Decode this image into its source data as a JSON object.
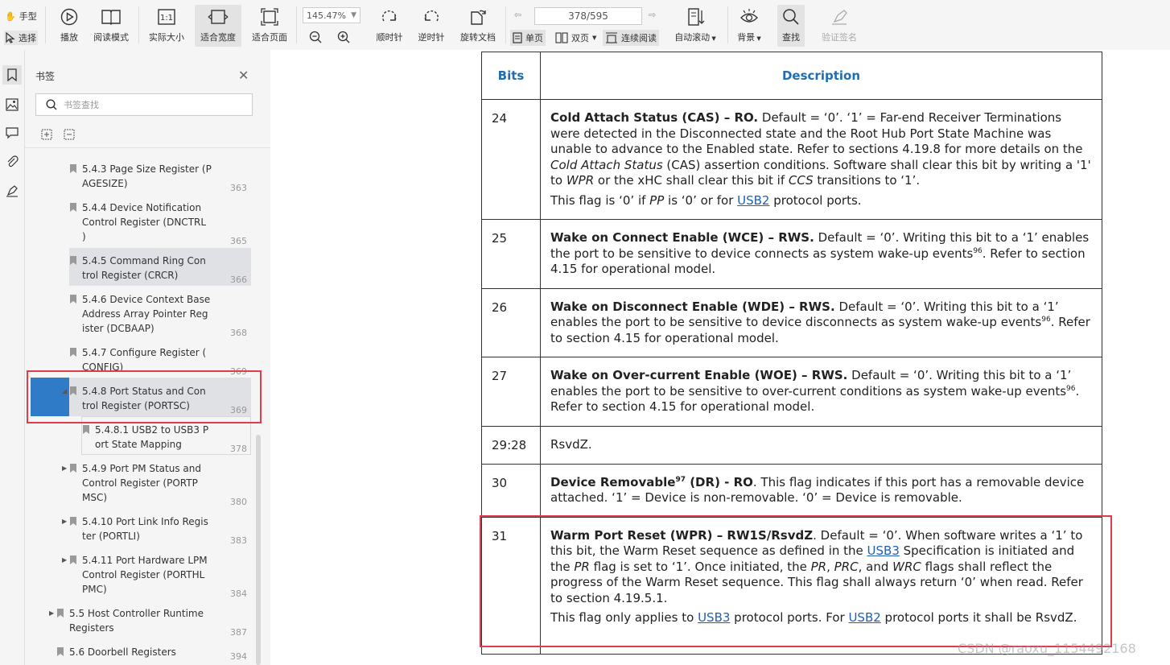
{
  "toolbar": {
    "hand_tool": "手型",
    "select_tool": "选择",
    "play": "播放",
    "read_mode": "阅读模式",
    "actual_size": "实际大小",
    "fit_width": "适合宽度",
    "fit_page": "适合页面",
    "zoom_value": "145.47%",
    "rotate_cw": "顺时针",
    "rotate_ccw": "逆时针",
    "rotate_doc": "旋转文档",
    "page_current": "378/595",
    "single_page": "单页",
    "double_page": "双页",
    "continuous": "连续阅读",
    "auto_scroll": "自动滚动",
    "background": "背景",
    "find": "查找",
    "verify_sign": "验证签名"
  },
  "panel": {
    "title": "书签",
    "search_placeholder": "书签查找",
    "bookmarks": [
      {
        "line1": "5.4.3 Page Size Register (P",
        "line2": "AGESIZE)",
        "line3": "",
        "page": "363"
      },
      {
        "line1": "5.4.4 Device Notification",
        "line2": "Control Register (DNCTRL",
        "line3": ")",
        "page": "365"
      },
      {
        "line1": "5.4.5 Command Ring Con",
        "line2": "trol Register (CRCR)",
        "line3": "",
        "page": "366"
      },
      {
        "line1": "5.4.6 Device Context Base",
        "line2": "Address Array Pointer Reg",
        "line3": "ister (DCBAAP)",
        "page": "368"
      },
      {
        "line1": "5.4.7 Configure Register (",
        "line2": "CONFIG)",
        "line3": "",
        "page": "369"
      },
      {
        "line1": "5.4.8 Port Status and Con",
        "line2": "trol Register (PORTSC)",
        "line3": "",
        "page": "369"
      },
      {
        "line1": "5.4.8.1 USB2 to USB3 P",
        "line2": "ort State Mapping",
        "line3": "",
        "page": "378"
      },
      {
        "line1": "5.4.9 Port PM Status and",
        "line2": "Control Register (PORTP",
        "line3": "MSC)",
        "page": "380"
      },
      {
        "line1": "5.4.10 Port Link Info Regis",
        "line2": "ter (PORTLI)",
        "line3": "",
        "page": "383"
      },
      {
        "line1": "5.4.11 Port Hardware LPM",
        "line2": "Control Register (PORTHL",
        "line3": "PMC)",
        "page": "384"
      },
      {
        "line1": "5.5 Host Controller Runtime",
        "line2": "Registers",
        "line3": "",
        "page": "387"
      },
      {
        "line1": "5.6 Doorbell Registers",
        "line2": "",
        "line3": "",
        "page": "394"
      }
    ]
  },
  "table": {
    "header_bits": "Bits",
    "header_desc": "Description",
    "rows": {
      "r24": {
        "bits": "24",
        "title": "Cold Attach Status (CAS) – RO.",
        "t1": " Default = ‘0’. ‘1’ = Far-end Receiver Terminations were detected in the Disconnected state and the Root Hub Port State Machine was unable to advance to the Enabled state. Refer to sections 4.19.8 for more details on the ",
        "i1": "Cold Attach Status",
        "t2": " (CAS) assertion conditions. Software shall clear this bit by writing a '1' to ",
        "i2": "WPR",
        "t3": " or the xHC shall clear this bit if ",
        "i3": "CCS",
        "t4": " transitions to ‘1’.",
        "p2a": "This flag is ‘0’ if ",
        "p2i": "PP",
        "p2b": " is ‘0’ or for ",
        "p2link": "USB2",
        "p2c": " protocol ports."
      },
      "r25": {
        "bits": "25",
        "title": "Wake on Connect Enable (WCE) – RWS.",
        "t1": " Default = ‘0’. Writing this bit to a ‘1’ enables the port to be sensitive to device connects as system wake-up events",
        "sup": "96",
        "t2": ". Refer to section 4.15 for operational model."
      },
      "r26": {
        "bits": "26",
        "title": "Wake on Disconnect Enable (WDE) – RWS.",
        "t1": " Default = ‘0’. Writing this bit to a ‘1’ enables the port to be sensitive to device disconnects as system wake-up events",
        "sup": "96",
        "t2": ". Refer to section 4.15 for operational model."
      },
      "r27": {
        "bits": "27",
        "title": "Wake on Over-current Enable (WOE) – RWS.",
        "t1": " Default = ‘0’. Writing this bit to a ‘1’ enables the port to be sensitive to over-current conditions as system wake-up events",
        "sup": "96",
        "t2": ". Refer to section 4.15 for operational model."
      },
      "r2928": {
        "bits": "29:28",
        "text": "RsvdZ."
      },
      "r30": {
        "bits": "30",
        "title": "Device Removable",
        "sup": "97",
        "title2": " (DR) - RO",
        "t1": ". This flag indicates if this port has a removable device attached. ‘1’ = Device is non-removable. ‘0’ = Device is removable."
      },
      "r31": {
        "bits": "31",
        "title": "Warm Port Reset (WPR) – RW1S/RsvdZ",
        "t1": ". Default = ‘0’. When software writes a ‘1’ to this bit, the Warm Reset sequence as defined in the ",
        "link1": "USB3",
        "t2": " Specification is initiated and the ",
        "i1": "PR",
        "t3": " flag is set to ‘1’. Once initiated, the ",
        "i2": "PR",
        "t4": ", ",
        "i3": "PRC",
        "t5": ", and ",
        "i4": "WRC",
        "t6": " flags shall reflect the progress of the Warm Reset sequence. This flag shall always return ‘0’ when read. Refer to section 4.19.5.1.",
        "p2a": "This flag only applies to ",
        "p2link1": "USB3",
        "p2b": " protocol ports. For ",
        "p2link2": "USB2",
        "p2c": " protocol ports it shall be RsvdZ."
      }
    }
  },
  "watermark": "CSDN @raoxu_1154492168",
  "colors": {
    "accent": "#2f7bc8",
    "highlight_box": "#e23b4b",
    "header_text": "#1f6db5",
    "link": "#1f5fb5"
  }
}
